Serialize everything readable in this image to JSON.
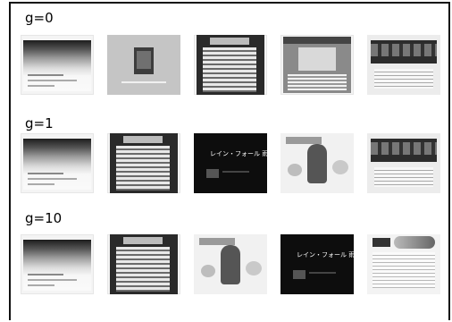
{
  "rows": [
    {
      "label": "g=0",
      "thumbs": [
        "gradient",
        "gray",
        "dark",
        "mid",
        "photo"
      ]
    },
    {
      "label": "g=1",
      "thumbs": [
        "gradient",
        "dark",
        "black",
        "girl",
        "photo"
      ]
    },
    {
      "label": "g=10",
      "thumbs": [
        "gradient",
        "dark",
        "girl",
        "black",
        "news"
      ]
    }
  ],
  "black_title_text": "レイン・フォール 雨の牙"
}
